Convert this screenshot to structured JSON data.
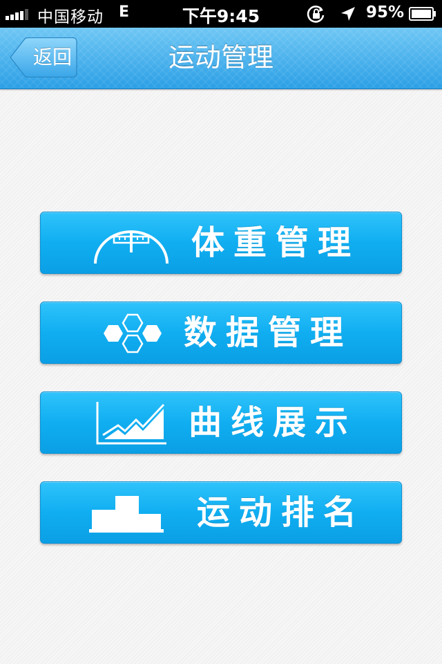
{
  "status_bar": {
    "carrier": "中国移动",
    "network": "E",
    "time": "下午9:45",
    "battery": "95%"
  },
  "nav": {
    "back_label": "返回",
    "title": "运动管理"
  },
  "menu": {
    "items": [
      {
        "label": "体重管理",
        "icon": "weight-scale-icon"
      },
      {
        "label": "数据管理",
        "icon": "hexagons-icon"
      },
      {
        "label": "曲线展示",
        "icon": "line-chart-icon"
      },
      {
        "label": "运动排名",
        "icon": "podium-icon"
      }
    ]
  },
  "colors": {
    "nav_bar": "#3aa9ec",
    "button": "#13b0f2",
    "text": "#ffffff"
  }
}
